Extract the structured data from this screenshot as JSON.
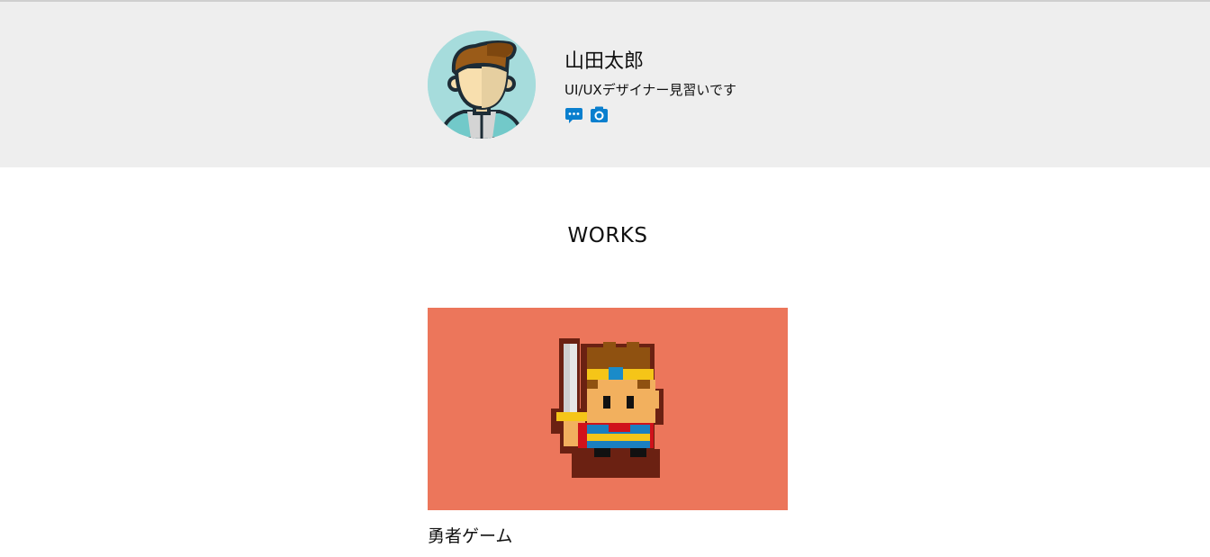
{
  "profile": {
    "name": "山田太郎",
    "bio": "UI/UXデザイナー見習いです",
    "social": [
      {
        "icon": "chat-bubble-icon",
        "color": "#0a7fce"
      },
      {
        "icon": "camera-icon",
        "color": "#0a7fce"
      }
    ]
  },
  "works": {
    "section_title": "WORKS",
    "items": [
      {
        "title": "勇者ゲーム",
        "thumbnail_bg": "#ec765b",
        "thumbnail_icon": "pixel-hero-icon"
      }
    ]
  },
  "colors": {
    "header_bg": "#eeeeee",
    "avatar_bg": "#a6dcdc",
    "accent": "#0a7fce"
  }
}
